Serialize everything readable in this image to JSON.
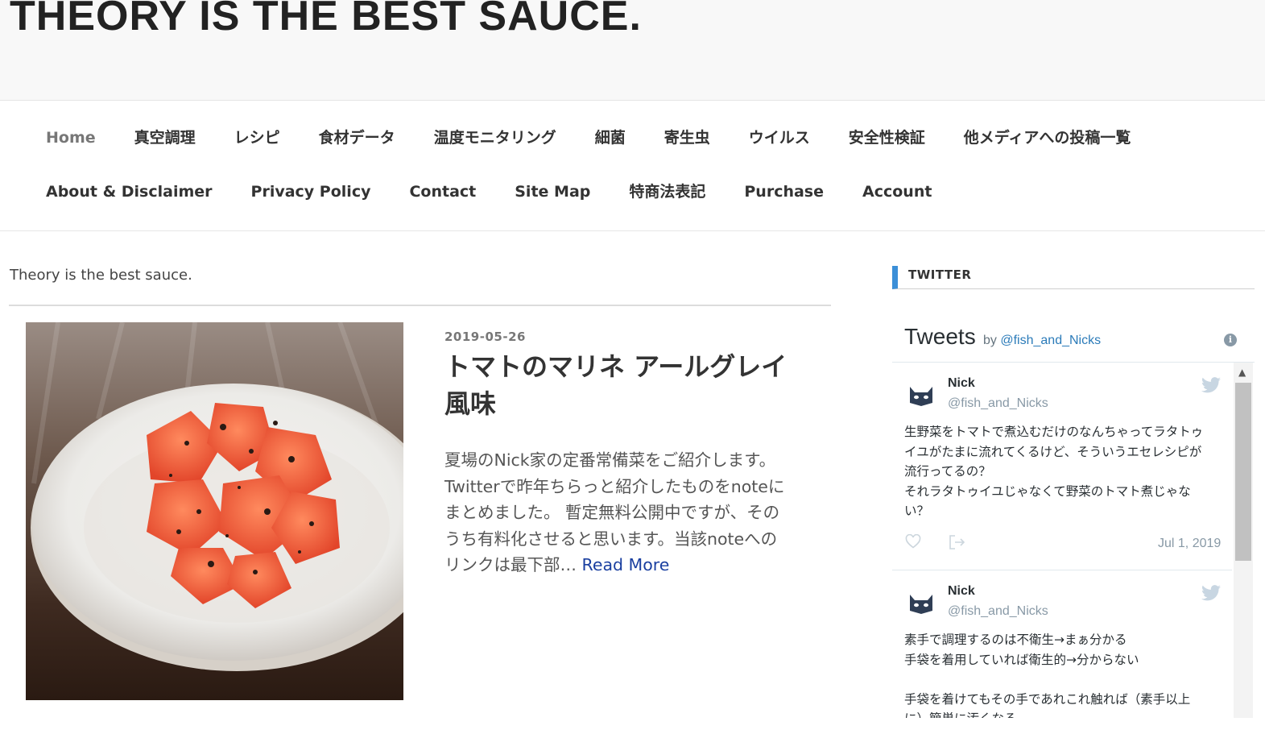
{
  "site": {
    "title": "THEORY IS THE BEST SAUCE."
  },
  "nav": {
    "row1": [
      "Home",
      "真空調理",
      "レシピ",
      "食材データ",
      "温度モニタリング",
      "細菌",
      "寄生虫",
      "ウイルス",
      "安全性検証",
      "他メディアへの投稿一覧"
    ],
    "row2": [
      "About & Disclaimer",
      "Privacy Policy",
      "Contact",
      "Site Map",
      "特商法表記",
      "Purchase",
      "Account"
    ]
  },
  "tagline": "Theory is the best sauce.",
  "post": {
    "date": "2019-05-26",
    "title_line1": "トマトのマリネ アールグレイ",
    "title_line2": "風味",
    "excerpt_lines": [
      "夏場のNick家の定番常備菜をご紹介します。",
      "Twitterで昨年ちらっと紹介したものをnoteに",
      "まとめました。 暫定無料公開中ですが、その",
      "うち有料化させると思います。当該noteへの",
      "リンクは最下部…"
    ],
    "read_more": "Read More"
  },
  "sidebar": {
    "widget_title": "TWITTER",
    "twitter": {
      "tweets_label": "Tweets",
      "by_label": "by",
      "handle": "@fish_and_Nicks",
      "tweets": [
        {
          "name": "Nick",
          "handle": "@fish_and_Nicks",
          "lines": [
            "生野菜をトマトで煮込むだけのなんちゃってラタトゥ",
            "イユがたまに流れてくるけど、そういうエセレシピが",
            "流行ってるの？",
            "それラタトゥイユじゃなくて野菜のトマト煮じゃな",
            "い？"
          ],
          "date": "Jul 1, 2019"
        },
        {
          "name": "Nick",
          "handle": "@fish_and_Nicks",
          "lines": [
            "素手で調理するのは不衛生→まぁ分かる",
            "手袋を着用していれば衛生的→分からない",
            "",
            "手袋を着けてもその手であれこれ触れば（素手以上",
            "に）簡単に汚くなる"
          ]
        }
      ]
    }
  },
  "colors": {
    "accent_blue": "#3b8fd8",
    "link_blue": "#1a3fa0",
    "twitter_blue": "#2b7bb9",
    "header_bg": "#f8f8f8"
  },
  "icons": {
    "info": "info-icon",
    "bird": "twitter-bird-icon",
    "heart": "heart-icon",
    "share": "share-icon",
    "scroll_up": "chevron-up-icon"
  }
}
